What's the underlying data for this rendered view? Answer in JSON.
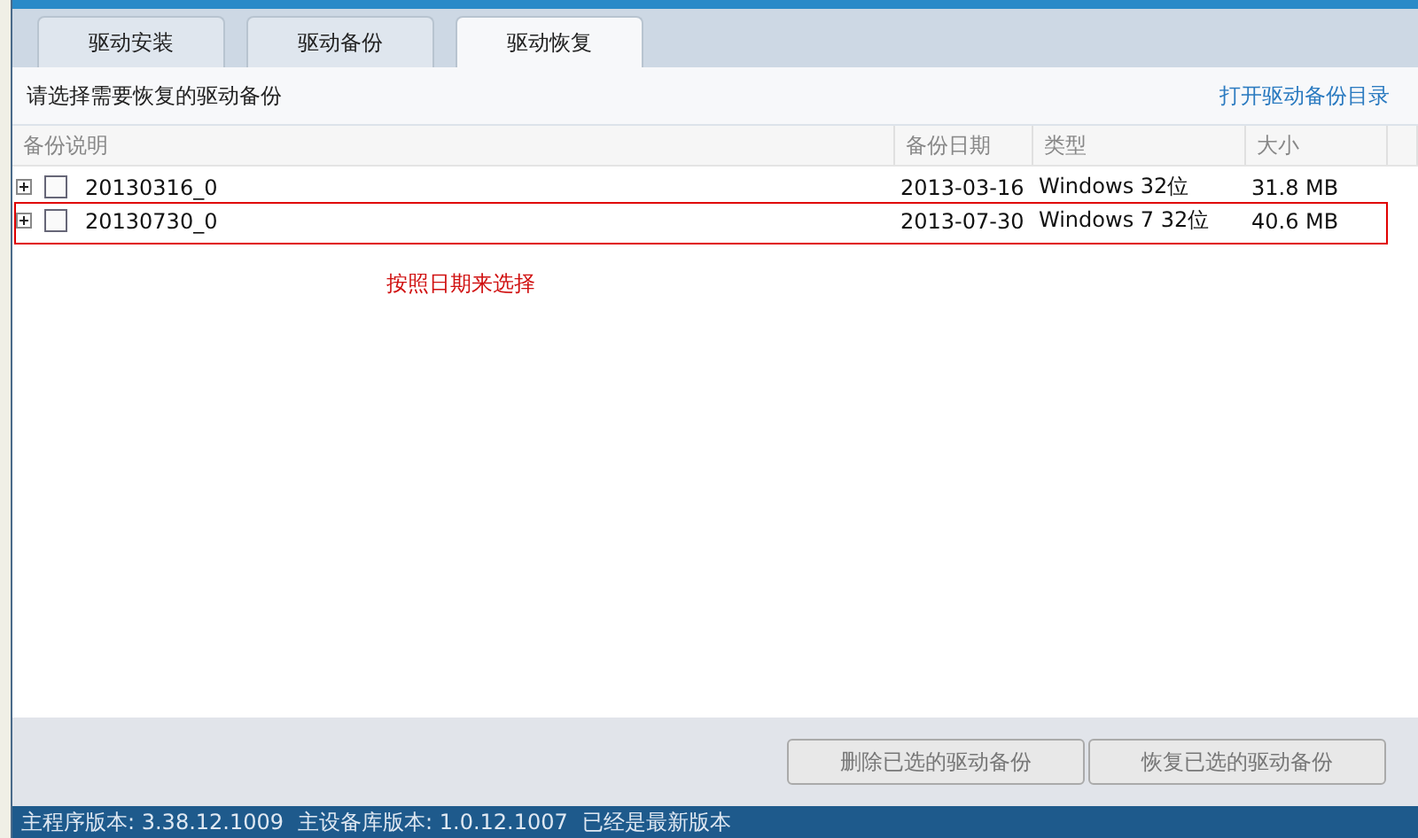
{
  "tabs": [
    {
      "label": "驱动安装",
      "selected": false
    },
    {
      "label": "驱动备份",
      "selected": false
    },
    {
      "label": "驱动恢复",
      "selected": true
    }
  ],
  "prompt": "请选择需要恢复的驱动备份",
  "link": "打开驱动备份目录",
  "table": {
    "columns": [
      "备份说明",
      "备份日期",
      "类型",
      "大小"
    ],
    "rows": [
      {
        "name": "20130316_0",
        "date": "2013-03-16",
        "type": "Windows 32位",
        "size": "31.8 MB",
        "checked": false,
        "expanded": false,
        "highlighted": false
      },
      {
        "name": "20130730_0",
        "date": "2013-07-30",
        "type": "Windows 7 32位",
        "size": "40.6 MB",
        "checked": false,
        "expanded": false,
        "highlighted": true
      }
    ]
  },
  "annotation": "按照日期来选择",
  "buttons": [
    {
      "label": "删除已选的驱动备份",
      "disabled": true
    },
    {
      "label": "恢复已选的驱动备份",
      "disabled": true
    }
  ],
  "status_bar": [
    "主程序版本: 3.38.12.1009",
    "主设备库版本: 1.0.12.1007",
    "已经是最新版本"
  ]
}
